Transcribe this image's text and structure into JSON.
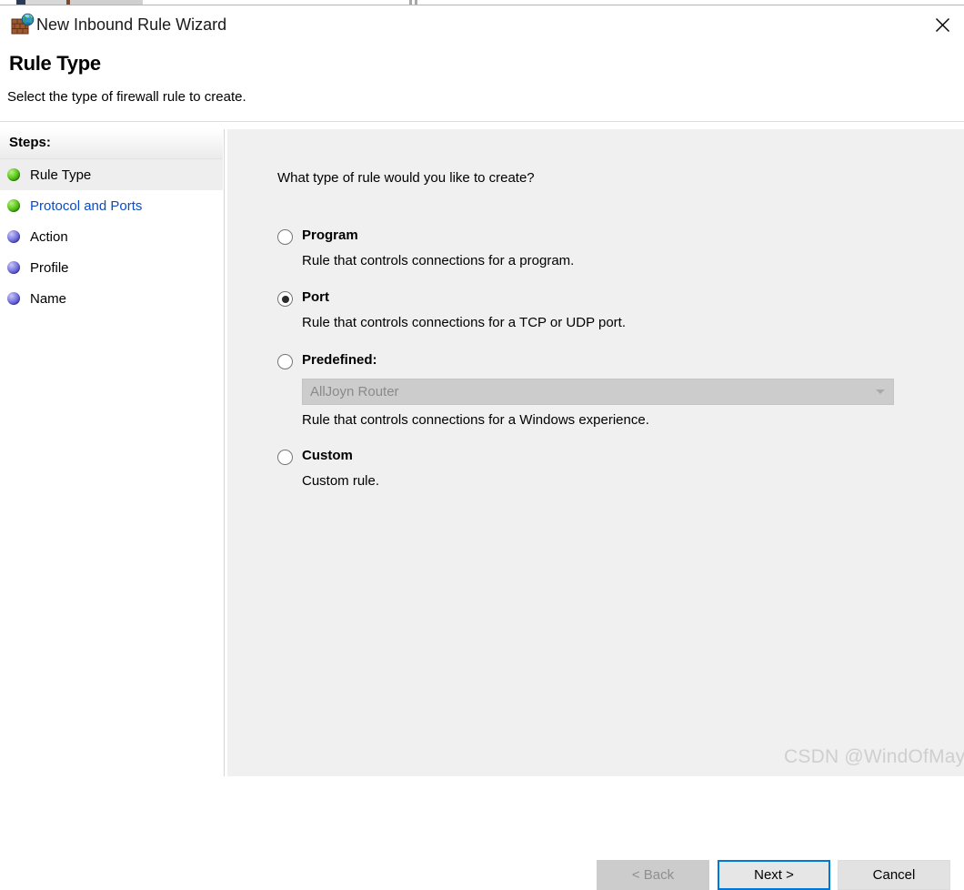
{
  "window": {
    "title": "New Inbound Rule Wizard",
    "icon": "firewall-globe-icon",
    "close_label": "✕"
  },
  "header": {
    "title": "Rule Type",
    "subtitle": "Select the type of firewall rule to create."
  },
  "sidebar": {
    "heading": "Steps:",
    "items": [
      {
        "label": "Rule Type",
        "state": "active",
        "bullet": "green"
      },
      {
        "label": "Protocol and Ports",
        "state": "link",
        "bullet": "green"
      },
      {
        "label": "Action",
        "state": "pending",
        "bullet": "blue"
      },
      {
        "label": "Profile",
        "state": "pending",
        "bullet": "blue"
      },
      {
        "label": "Name",
        "state": "pending",
        "bullet": "blue"
      }
    ]
  },
  "main": {
    "question": "What type of rule would you like to create?",
    "options": [
      {
        "id": "program",
        "title": "Program",
        "description": "Rule that controls connections for a program.",
        "selected": false
      },
      {
        "id": "port",
        "title": "Port",
        "description": "Rule that controls connections for a TCP or UDP port.",
        "selected": true
      },
      {
        "id": "predefined",
        "title": "Predefined:",
        "description": "Rule that controls connections for a Windows experience.",
        "selected": false,
        "dropdown": {
          "value": "AllJoyn Router",
          "disabled": true
        }
      },
      {
        "id": "custom",
        "title": "Custom",
        "description": "Custom rule.",
        "selected": false
      }
    ]
  },
  "footer": {
    "back_label": "< Back",
    "next_label": "Next >",
    "cancel_label": "Cancel",
    "back_disabled": true,
    "next_focused": true
  },
  "watermark": {
    "text": "CSDN @WindOfMayGIS"
  },
  "colors": {
    "accent": "#0078d7",
    "panel_bg": "#f0f0f0",
    "link": "#0b4cc4",
    "disabled_text": "#8f8f8f"
  }
}
